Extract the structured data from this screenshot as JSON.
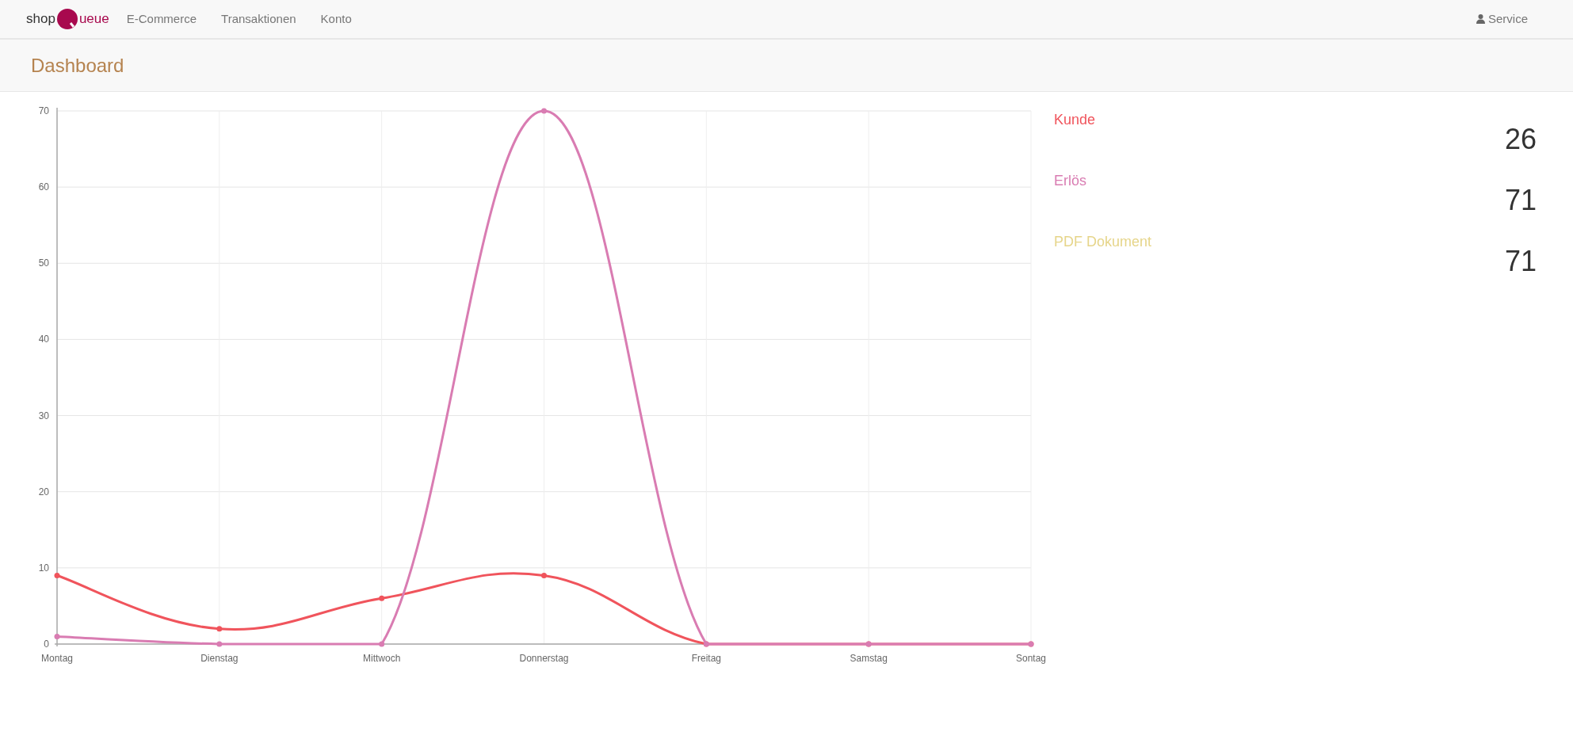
{
  "navbar": {
    "logo": {
      "prefix": "shop",
      "suffix": "ueue"
    },
    "items": [
      {
        "label": "E-Commerce"
      },
      {
        "label": "Transaktionen"
      },
      {
        "label": "Konto"
      }
    ],
    "service": {
      "label": "Service"
    }
  },
  "header": {
    "title": "Dashboard"
  },
  "chart": {
    "chart_data": {
      "type": "line",
      "categories": [
        "Montag",
        "Dienstag",
        "Mittwoch",
        "Donnerstag",
        "Freitag",
        "Samstag",
        "Sontag"
      ],
      "ylim": [
        0,
        70
      ],
      "yticks": [
        0,
        10,
        20,
        30,
        40,
        50,
        60,
        70
      ],
      "grid": true,
      "series": [
        {
          "color": "#f0545c",
          "marker": true,
          "values": [
            9,
            2,
            6,
            9,
            0,
            0,
            0
          ]
        },
        {
          "color": "#d97cb2",
          "marker": true,
          "values": [
            1,
            0,
            0,
            70,
            0,
            0,
            0
          ]
        }
      ]
    }
  },
  "stats": [
    {
      "label": "Kunde",
      "value": "26",
      "color": "#f0545c"
    },
    {
      "label": "Erlös",
      "value": "71",
      "color": "#d97cb2"
    },
    {
      "label": "PDF Dokument",
      "value": "71",
      "color": "#e6d58a"
    }
  ]
}
